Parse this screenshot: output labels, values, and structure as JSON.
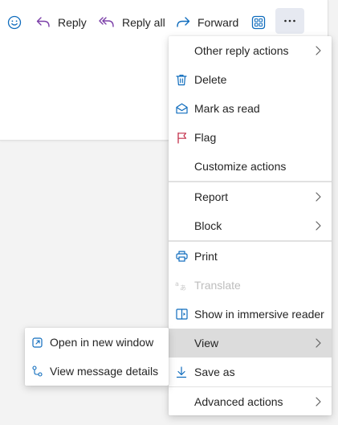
{
  "toolbar": {
    "emoji_icon": "emoji-smile-icon",
    "reply_label": "Reply",
    "reply_all_label": "Reply all",
    "forward_label": "Forward",
    "apps_icon": "apps-grid-icon",
    "more_icon": "more-horizontal-icon",
    "accent_color": "#7b3fa8",
    "forward_color": "#0f6cbd"
  },
  "menu": {
    "items": [
      {
        "label": "Other reply actions",
        "icon": "",
        "submenu": true
      },
      {
        "label": "Delete",
        "icon": "trash-icon"
      },
      {
        "label": "Mark as read",
        "icon": "envelope-open-icon"
      },
      {
        "label": "Flag",
        "icon": "flag-icon"
      },
      {
        "label": "Customize actions",
        "icon": ""
      },
      {
        "label": "Report",
        "icon": "",
        "submenu": true
      },
      {
        "label": "Block",
        "icon": "",
        "submenu": true
      },
      {
        "label": "Print",
        "icon": "printer-icon"
      },
      {
        "label": "Translate",
        "icon": "translate-icon",
        "disabled": true
      },
      {
        "label": "Show in immersive reader",
        "icon": "immersive-reader-icon"
      },
      {
        "label": "View",
        "icon": "",
        "submenu": true,
        "selected": true
      },
      {
        "label": "Save as",
        "icon": "download-icon"
      },
      {
        "label": "Advanced actions",
        "icon": "",
        "submenu": true
      }
    ]
  },
  "submenu": {
    "items": [
      {
        "label": "Open in new window",
        "icon": "open-in-new-window-icon"
      },
      {
        "label": "View message details",
        "icon": "message-details-icon"
      }
    ]
  }
}
